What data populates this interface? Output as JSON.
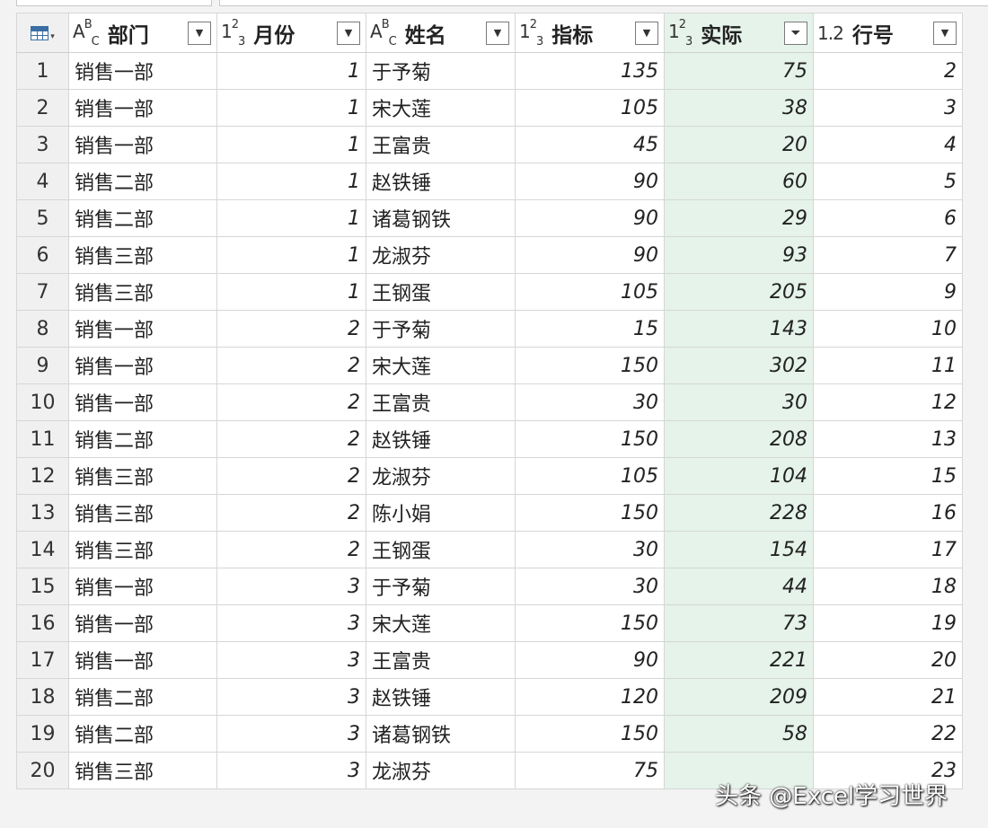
{
  "columns": [
    {
      "type_icon": "ABC",
      "label": "部门",
      "kind": "text",
      "filter": false
    },
    {
      "type_icon": "123",
      "label": "月份",
      "kind": "num",
      "filter": false
    },
    {
      "type_icon": "ABC",
      "label": "姓名",
      "kind": "text",
      "filter": false
    },
    {
      "type_icon": "123",
      "label": "指标",
      "kind": "num",
      "filter": false
    },
    {
      "type_icon": "123",
      "label": "实际",
      "kind": "num",
      "filter": true,
      "selected": true
    },
    {
      "type_icon": "1.2",
      "label": "行号",
      "kind": "num",
      "filter": false
    }
  ],
  "rows": [
    [
      "1",
      "销售一部",
      "1",
      "于予菊",
      "135",
      "75",
      "2"
    ],
    [
      "2",
      "销售一部",
      "1",
      "宋大莲",
      "105",
      "38",
      "3"
    ],
    [
      "3",
      "销售一部",
      "1",
      "王富贵",
      "45",
      "20",
      "4"
    ],
    [
      "4",
      "销售二部",
      "1",
      "赵铁锤",
      "90",
      "60",
      "5"
    ],
    [
      "5",
      "销售二部",
      "1",
      "诸葛钢铁",
      "90",
      "29",
      "6"
    ],
    [
      "6",
      "销售三部",
      "1",
      "龙淑芬",
      "90",
      "93",
      "7"
    ],
    [
      "7",
      "销售三部",
      "1",
      "王钢蛋",
      "105",
      "205",
      "9"
    ],
    [
      "8",
      "销售一部",
      "2",
      "于予菊",
      "15",
      "143",
      "10"
    ],
    [
      "9",
      "销售一部",
      "2",
      "宋大莲",
      "150",
      "302",
      "11"
    ],
    [
      "10",
      "销售一部",
      "2",
      "王富贵",
      "30",
      "30",
      "12"
    ],
    [
      "11",
      "销售二部",
      "2",
      "赵铁锤",
      "150",
      "208",
      "13"
    ],
    [
      "12",
      "销售三部",
      "2",
      "龙淑芬",
      "105",
      "104",
      "15"
    ],
    [
      "13",
      "销售三部",
      "2",
      "陈小娟",
      "150",
      "228",
      "16"
    ],
    [
      "14",
      "销售三部",
      "2",
      "王钢蛋",
      "30",
      "154",
      "17"
    ],
    [
      "15",
      "销售一部",
      "3",
      "于予菊",
      "30",
      "44",
      "18"
    ],
    [
      "16",
      "销售一部",
      "3",
      "宋大莲",
      "150",
      "73",
      "19"
    ],
    [
      "17",
      "销售一部",
      "3",
      "王富贵",
      "90",
      "221",
      "20"
    ],
    [
      "18",
      "销售二部",
      "3",
      "赵铁锤",
      "120",
      "209",
      "21"
    ],
    [
      "19",
      "销售二部",
      "3",
      "诸葛钢铁",
      "150",
      "58",
      "22"
    ],
    [
      "20",
      "销售三部",
      "3",
      "龙淑芬",
      "75",
      "",
      "23"
    ]
  ],
  "watermark": "头条 @Excel学习世界",
  "colors": {
    "selected_column": "#e5f3eb",
    "grid_line": "#d6d6d6",
    "row_header": "#f0f0f0"
  }
}
